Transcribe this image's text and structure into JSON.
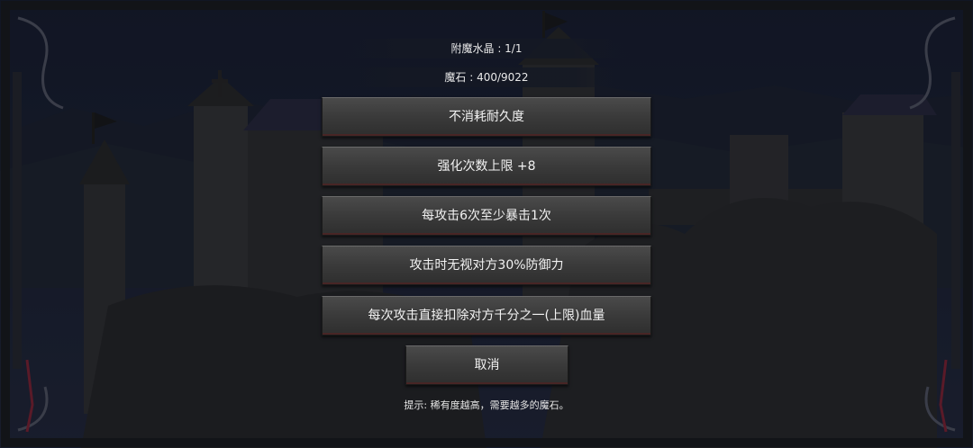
{
  "info": {
    "crystal_label": "附魔水晶 : 1/1",
    "stone_label": "魔石 : 400/9022"
  },
  "options": [
    "不消耗耐久度",
    "强化次数上限 +8",
    "每攻击6次至少暴击1次",
    "攻击时无视对方30%防御力",
    "每次攻击直接扣除对方千分之一(上限)血量"
  ],
  "cancel_label": "取消",
  "hint": "提示: 稀有度越高，需要越多的魔石。"
}
